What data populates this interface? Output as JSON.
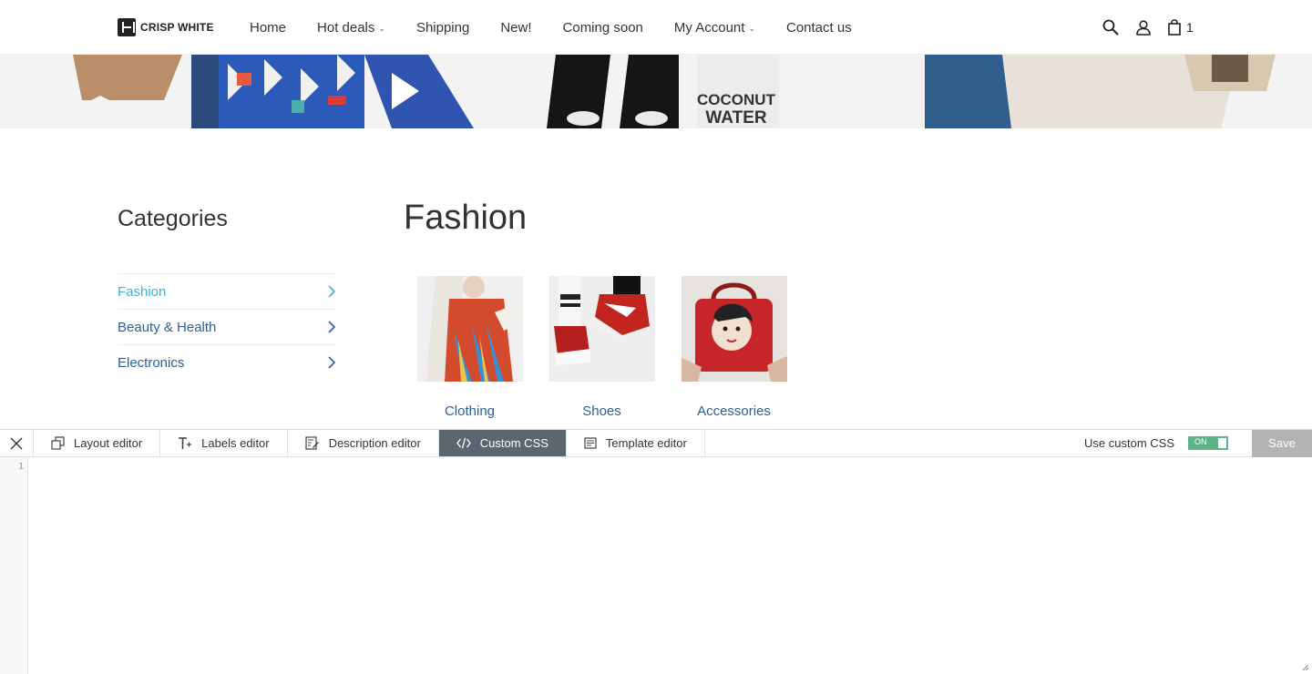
{
  "header": {
    "brand": "CRISP WHITE",
    "nav": [
      {
        "label": "Home",
        "dropdown": false
      },
      {
        "label": "Hot deals",
        "dropdown": true
      },
      {
        "label": "Shipping",
        "dropdown": false
      },
      {
        "label": "New!",
        "dropdown": false
      },
      {
        "label": "Coming soon",
        "dropdown": false
      },
      {
        "label": "My Account",
        "dropdown": true
      },
      {
        "label": "Contact us",
        "dropdown": false
      }
    ],
    "cart_count": "1",
    "icons": [
      "search-icon",
      "user-icon",
      "bag-icon"
    ]
  },
  "banner": {
    "product_text_1": "COCONUT",
    "product_text_2": "WATER"
  },
  "sidebar": {
    "title": "Categories",
    "items": [
      {
        "label": "Fashion",
        "active": true
      },
      {
        "label": "Beauty & Health",
        "active": false
      },
      {
        "label": "Electronics",
        "active": false
      }
    ]
  },
  "main": {
    "title": "Fashion",
    "subcategories": [
      {
        "label": "Clothing"
      },
      {
        "label": "Shoes"
      },
      {
        "label": "Accessories"
      }
    ]
  },
  "editor": {
    "tabs": [
      {
        "label": "Layout editor",
        "icon": "layout-icon",
        "active": false
      },
      {
        "label": "Labels editor",
        "icon": "text-plus-icon",
        "active": false
      },
      {
        "label": "Description editor",
        "icon": "edit-doc-icon",
        "active": false
      },
      {
        "label": "Custom CSS",
        "icon": "code-icon",
        "active": true
      },
      {
        "label": "Template editor",
        "icon": "template-icon",
        "active": false
      }
    ],
    "custom_css_label": "Use custom CSS",
    "toggle_state": "ON",
    "save_label": "Save",
    "line_number": "1"
  },
  "colors": {
    "link": "#2c5f99",
    "active_link": "#3fb2d5",
    "active_tab": "#5d6670",
    "toggle_on": "#5cb38a",
    "save_disabled": "#b3b3b3"
  }
}
